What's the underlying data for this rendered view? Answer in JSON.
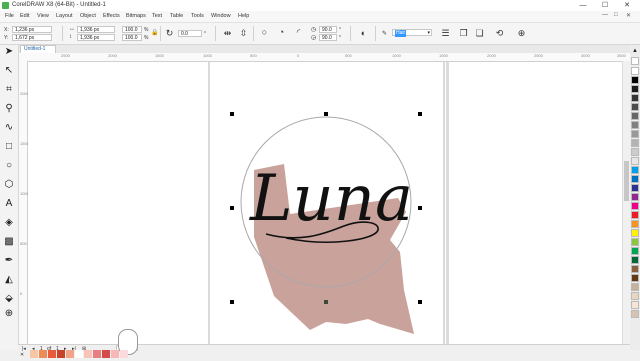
{
  "window": {
    "title": "CorelDRAW X8 (64-Bit) - Untitled-1",
    "minimize": "—",
    "maximize": "☐",
    "close": "✕"
  },
  "menu": {
    "items": [
      "File",
      "Edit",
      "View",
      "Layout",
      "Object",
      "Effects",
      "Bitmaps",
      "Text",
      "Table",
      "Tools",
      "Window",
      "Help"
    ],
    "doc_controls": [
      "—",
      "□",
      "✕"
    ]
  },
  "props": {
    "x_label": "X:",
    "x_value": "1,236 px",
    "y_label": "Y:",
    "y_value": "1,672 px",
    "w_value": "1,936 px",
    "h_value": "1,936 px",
    "scale_x": "100.0",
    "scale_y": "100.0",
    "pct": "%",
    "rotation": "0.0",
    "arc_start": "90.0",
    "arc_end": "90.0",
    "deg": "°",
    "outline": "Hair"
  },
  "tabs": {
    "document": "Untitled-1"
  },
  "rulers": {
    "h_ticks": [
      "2500",
      "2000",
      "1500",
      "1000",
      "500",
      "0",
      "500",
      "1000",
      "1500",
      "2000",
      "2500",
      "3000",
      "3500"
    ],
    "v_ticks": [
      "2000",
      "1500",
      "1000",
      "500",
      "0"
    ]
  },
  "canvas": {
    "artwork_text": "Luna",
    "blob_color": "#c9a29b",
    "circle_color": "#a9a9a9",
    "script_color": "#111111"
  },
  "status": {
    "page_current": "1",
    "page_of": "of",
    "page_total": "1",
    "page_tab": "Page 1"
  },
  "palette_colors": [
    "#ffffff",
    "#000000",
    "#1a1a1a",
    "#333333",
    "#4d4d4d",
    "#666666",
    "#808080",
    "#999999",
    "#b3b3b3",
    "#cccccc",
    "#e6e6e6",
    "#00a0e9",
    "#0070c0",
    "#2e3192",
    "#92278f",
    "#ec008c",
    "#ed1c24",
    "#f7941d",
    "#fff200",
    "#8dc63f",
    "#00a651",
    "#006837",
    "#8b5e3c",
    "#603913",
    "#c7b299",
    "#e8d6c1",
    "#f5e6d3",
    "#d8c3b0"
  ],
  "doc_palette": [
    "#f7c6a3",
    "#f08b56",
    "#e75b3c",
    "#c7432a",
    "#f3a488",
    "#ffffff",
    "#f9c3ba",
    "#e87f7f",
    "#d44a4a",
    "#f6b8b8",
    "#fadada"
  ]
}
